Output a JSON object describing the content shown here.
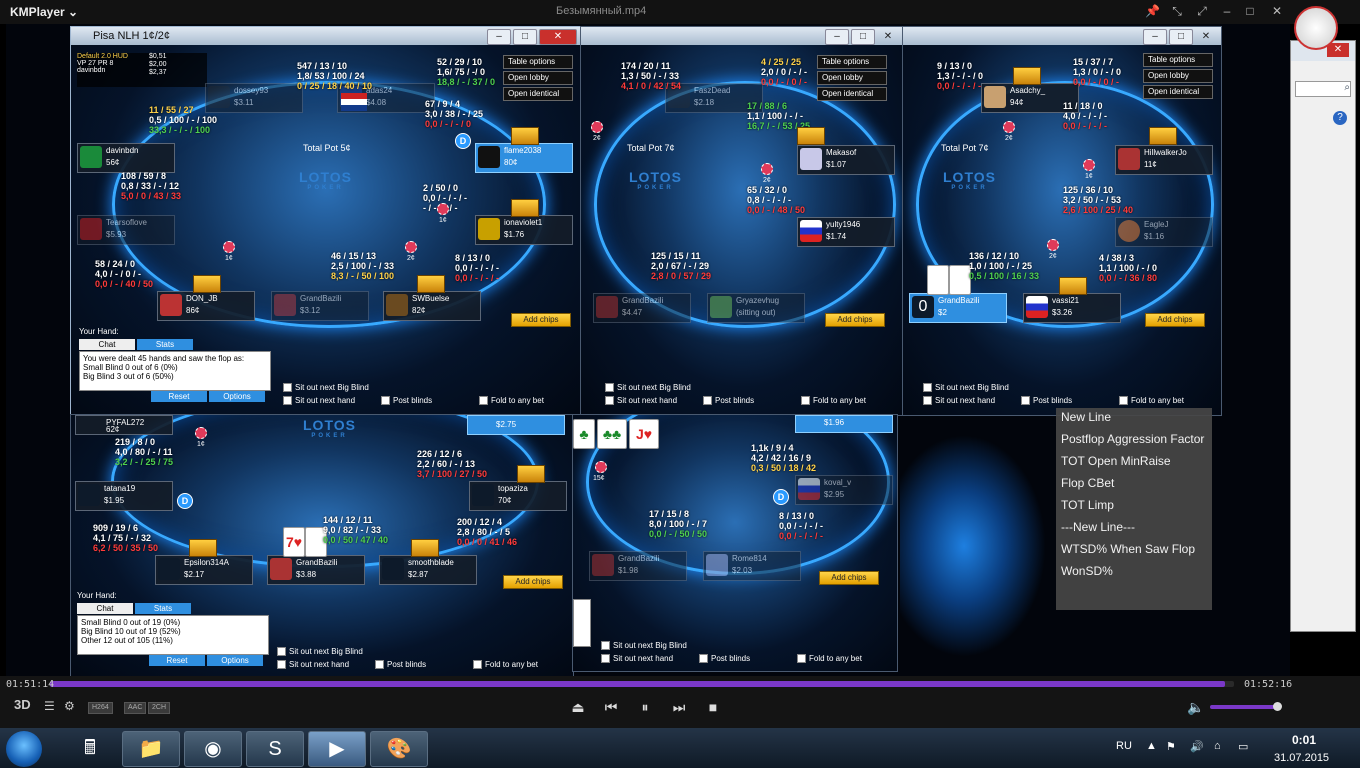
{
  "player": {
    "app_name": "KMPlayer",
    "file_name": "Безымянный.mp4",
    "time_elapsed": "01:51:14",
    "time_total": "01:52:16",
    "progress": 0.992,
    "codecs": [
      "H264",
      "AAC",
      "2CH"
    ],
    "accent": "#7a38c8"
  },
  "taskbar": {
    "language": "RU",
    "clock_time": "0:01",
    "clock_date": "31.07.2015"
  },
  "table_title": "Pisa NLH 1¢/2¢",
  "table_options": [
    "Table options",
    "Open lobby",
    "Open identical"
  ],
  "brand": {
    "logo": "LOTOS",
    "sub": "POKER"
  },
  "t1": {
    "hud_profile": "Default 2.0 HUD",
    "hud_header": [
      "VP 27  PR 8",
      "davinbdn",
      "hadas24"
    ],
    "hud_money": [
      "$0,51",
      "$2,00",
      "$2,37"
    ],
    "pot": "Total Pot 5¢",
    "seats": [
      {
        "name": "davinbdn",
        "stack": "56¢"
      },
      {
        "name": "dossey93",
        "stack": "$3.11"
      },
      {
        "name": "adas24",
        "stack": "$4.08"
      },
      {
        "name": "flame2038",
        "stack": "80¢"
      },
      {
        "name": "ionaviolet1",
        "stack": "$1.76"
      },
      {
        "name": "SWBuelse",
        "stack": "82¢"
      },
      {
        "name": "GrandBazili",
        "stack": "$3.12"
      },
      {
        "name": "DON_JB",
        "stack": "86¢"
      },
      {
        "name": "Tearsoflove",
        "stack": "$5.93"
      }
    ],
    "chips": [
      "1¢",
      "2¢",
      "2¢",
      "1¢"
    ],
    "hud": [
      [
        "52 / 29 / 10",
        "1,6/ 75 / -/ 0",
        "18,8 / - / 37 / 0"
      ],
      [
        "547 / 13 / 10",
        "1,8/ 53 / 100 / 24",
        "0 / 25 / 18 / 40 / 10"
      ],
      [
        "11 / 55 / 27",
        "0,5 / 100 / - / 100",
        "33,3 / - / - / 100"
      ],
      [
        "67 / 9 / 4",
        "3,0 / 38 / - / 25",
        "0,0 / - / - / 0"
      ],
      [
        "108 / 59 / 8",
        "0,8 / 33 / - / 12",
        "5,0 / 0 / 43 / 33"
      ],
      [
        "2 / 50 / 0",
        "0,0 / - / - / -",
        "- / - / - / -"
      ],
      [
        "46 / 15 / 13",
        "2,5 / 100 / - / 33",
        "8,3 / - / 50 / 100"
      ],
      [
        "8 / 13 / 0",
        "0,0 / - / - / -",
        "0,0 / - / - / -"
      ],
      [
        "58 / 24 / 0",
        "4,0 / - / 0 / -",
        "0,0 / - / 40 / 50"
      ]
    ],
    "your_hand": "Your Hand:",
    "tab_chat": "Chat",
    "tab_stats": "Stats",
    "stats_lines": [
      "You were dealt 45 hands and saw the flop as:",
      "Small Blind        0 out of 6 (0%)",
      "Big Blind          3 out of 6 (50%)"
    ],
    "reset": "Reset",
    "options": "Options"
  },
  "t2": {
    "pot": "Total Pot 7¢",
    "seats": [
      {
        "name": "FaszDead",
        "stack": "$2.18"
      },
      {
        "name": "Makasof",
        "stack": "$1.07"
      },
      {
        "name": "yulty1946",
        "stack": "$1.74"
      },
      {
        "name": "GrandBazili",
        "stack": "$4.47"
      },
      {
        "name": "Gryazevhug",
        "stack": "(sitting out)"
      }
    ],
    "hud": [
      [
        "174 / 20 / 11",
        "1,3 / 50 / - / 33",
        "4,1 / 0 / 42 / 54"
      ],
      [
        "4 / 25 / 25",
        "2,0 / 0 / - / -",
        "0,0 / - / 0 / -"
      ],
      [
        "17 / 88 / 6",
        "1,1 / 100 / - / -",
        "16,7 / - / 53 / 25"
      ],
      [
        "65 / 32 / 0",
        "0,8 / - / - / -",
        "0,0 / - / 48 / 50"
      ],
      [
        "125 / 15 / 11",
        "2,0 / 67 / - / 29",
        "2,8 / 0 / 57 / 29"
      ]
    ],
    "chips": [
      "2¢",
      "2¢",
      "1¢"
    ]
  },
  "t3": {
    "pot": "Total Pot 7¢",
    "seats": [
      {
        "name": "Asadchy_",
        "stack": "94¢"
      },
      {
        "name": "HillwalkerJo",
        "stack": "11¢"
      },
      {
        "name": "EagleJ",
        "stack": "$1.16"
      },
      {
        "name": "GrandBazili",
        "stack": "$2"
      },
      {
        "name": "vassi21",
        "stack": "$3.26"
      }
    ],
    "hero_seat_num": "0",
    "hud": [
      [
        "9 / 13 / 0",
        "1,3 / - / - / 0",
        "0,0 / - / - / -"
      ],
      [
        "15 / 37 / 7",
        "1,3 / 0 / - / 0",
        "0,0 / - / 0 / -"
      ],
      [
        "11 / 18 / 0",
        "4,0 / - / - / -",
        "0,0 / - / - / -"
      ],
      [
        "125 / 36 / 10",
        "3,2 / 50 / - / 53",
        "2,6 / 100 / 25 / 40"
      ],
      [
        "136 / 12 / 10",
        "1,0 / 100 / - / 25",
        "0,5 / 100 / 16 / 33"
      ],
      [
        "4 / 38 / 3",
        "1,1 / 100 / - / 0",
        "0,0 / - / 36 / 80"
      ]
    ],
    "chips": [
      "2¢",
      "1¢",
      "2¢"
    ]
  },
  "t4": {
    "seats": [
      {
        "name": "PYFAL272",
        "stack": "62¢"
      },
      {
        "name": "tatana19",
        "stack": "$1.95"
      },
      {
        "name": "topaziza",
        "stack": "70¢"
      },
      {
        "name": "Epsilon314A",
        "stack": "$2.17"
      },
      {
        "name": "GrandBazili",
        "stack": "$3.88"
      },
      {
        "name": "smoothblade",
        "stack": "$2.87"
      },
      {
        "name": "",
        "stack": "$2.75"
      }
    ],
    "hud": [
      [
        "219 / 8 / 0",
        "4,0 / 80 / - / 11",
        "3,2 / - / 25 / 75"
      ],
      [
        "226 / 12 / 6",
        "2,2 / 60 / - / 13",
        "3,7 / 100 / 27 / 50"
      ],
      [
        "909 / 19 / 6",
        "4,1 / 75 / - / 32",
        "6,2 / 50 / 35 / 50"
      ],
      [
        "144 / 12 / 11",
        "9,0 / 82 / - / 33",
        "0,0 / 50 / 47 / 40"
      ],
      [
        "200 / 12 / 4",
        "2,8 / 80 / - / 5",
        "0,0 / 0 / 41 / 46"
      ]
    ],
    "chip": "1¢",
    "your_hand": "Your Hand:",
    "tab_chat": "Chat",
    "tab_stats": "Stats",
    "stats_lines": [
      "Small Blind        0 out of 19 (0%)",
      "Big Blind         10 out of 19 (52%)",
      "Other             12 out of 105 (11%)"
    ],
    "reset": "Reset",
    "options": "Options"
  },
  "t5": {
    "seats": [
      {
        "name": "",
        "stack": "$1.96"
      },
      {
        "name": "koval_v",
        "stack": "$2.95"
      },
      {
        "name": "GrandBazili",
        "stack": "$1.98"
      },
      {
        "name": "Rome814",
        "stack": "$2.03"
      }
    ],
    "hud": [
      [
        "1,1k / 9 / 4",
        "4,2 / 42 / 16 / 9",
        "0,3 / 50 / 18 / 42"
      ],
      [
        "17 / 15 / 8",
        "8,0 / 100 / - / 7",
        "0,0 / - / 50 / 50"
      ],
      [
        "8 / 13 / 0",
        "0,0 / - / - / -",
        "0,0 / - / - / -"
      ]
    ],
    "chip": "15¢"
  },
  "controls": {
    "sit_out_bb": "Sit out next Big Blind",
    "sit_out_hand": "Sit out next hand",
    "post_blinds": "Post blinds",
    "fold_any": "Fold to any bet",
    "add_chips": "Add chips"
  },
  "stats_panel": [
    "New Line",
    "Postflop Aggression Factor",
    "TOT Open MinRaise",
    "Flop CBet",
    "TOT Limp",
    "---New Line---",
    "WTSD% When Saw Flop",
    "WonSD%"
  ]
}
